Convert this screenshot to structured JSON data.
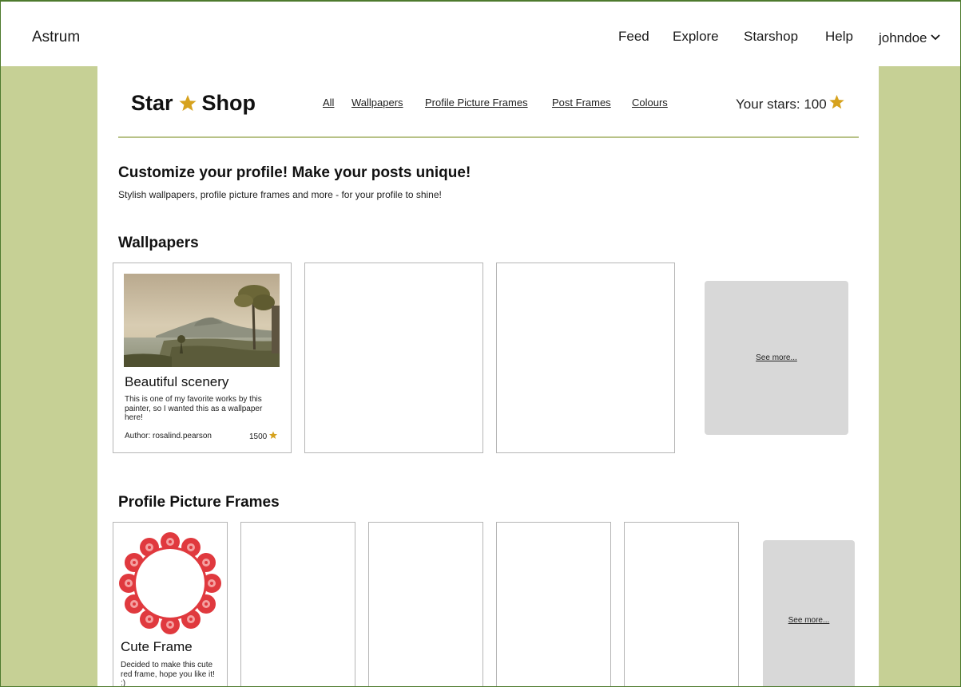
{
  "app": {
    "brand": "Astrum"
  },
  "nav": {
    "items": [
      {
        "label": "Feed"
      },
      {
        "label": "Explore"
      },
      {
        "label": "Starshop"
      },
      {
        "label": "Help"
      }
    ],
    "user": "johndoe"
  },
  "shop": {
    "title_left": "Star",
    "title_right": "Shop",
    "categories": [
      "All",
      "Wallpapers",
      "Profile Picture Frames",
      "Post Frames",
      "Colours"
    ],
    "stars_label": "Your stars: 100"
  },
  "intro": {
    "headline": "Customize your profile! Make your posts unique!",
    "subline": "Stylish wallpapers, profile picture frames and more - for your profile to shine!"
  },
  "sections": {
    "wallpapers": {
      "title": "Wallpapers",
      "featured": {
        "title": "Beautiful scenery",
        "description": "This is one of my favorite works by this painter, so I wanted this as a wallpaper here!",
        "author": "Author: rosalind.pearson",
        "price": "1500"
      },
      "see_more": "See more..."
    },
    "frames": {
      "title": "Profile Picture Frames",
      "featured": {
        "title": "Cute Frame",
        "description": "Decided to make this cute red frame, hope you like it! :)"
      },
      "see_more": "See more..."
    }
  },
  "colors": {
    "accent_star": "#d6a21e",
    "side_green": "#c6d095",
    "divider": "#b8c287",
    "frame_red": "#e0393e"
  },
  "icons": {
    "star": "star-icon",
    "chevron": "chevron-down-icon"
  }
}
